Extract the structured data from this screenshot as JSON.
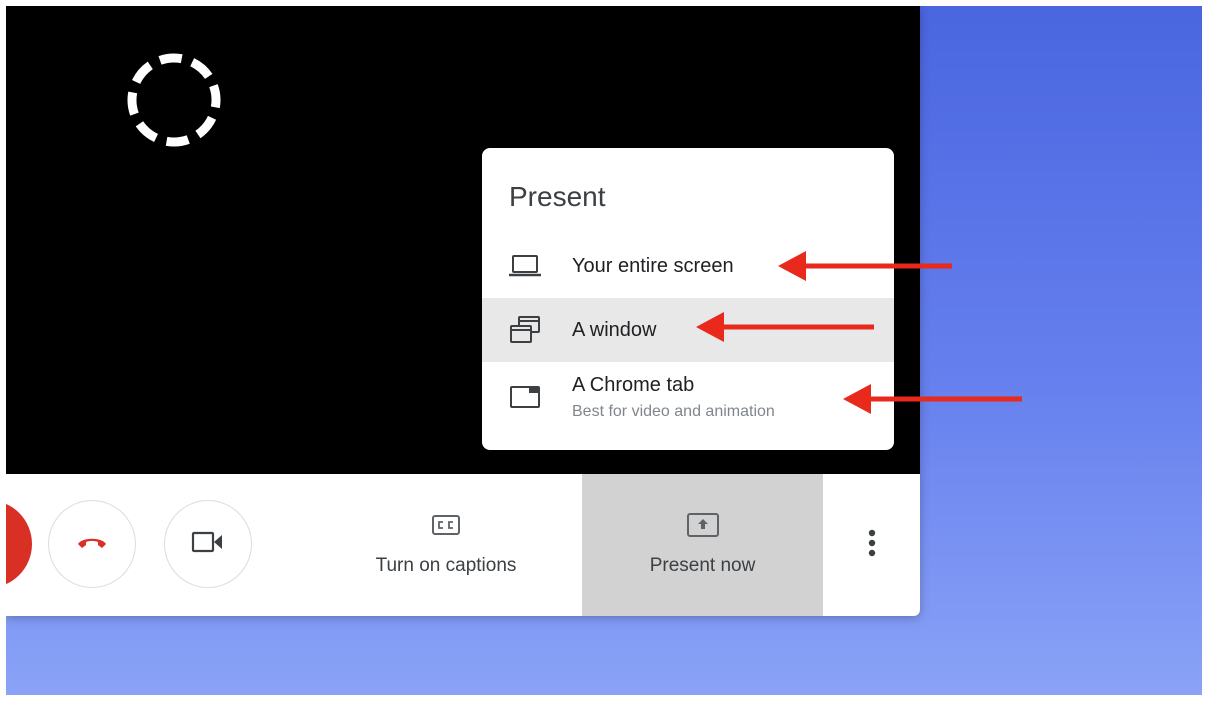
{
  "menu": {
    "title": "Present",
    "items": [
      {
        "label": "Your entire screen",
        "icon": "laptop-icon"
      },
      {
        "label": "A window",
        "icon": "window-icon"
      },
      {
        "label": "A Chrome tab",
        "sublabel": "Best for video and animation",
        "icon": "browser-tab-icon"
      }
    ],
    "highlighted_item": "A window"
  },
  "controls": {
    "captions_label": "Turn on captions",
    "present_label": "Present now"
  },
  "colors": {
    "hangup_red": "#d93025",
    "arrow_red": "#e8291c",
    "present_active_bg": "#d2d2d2",
    "desktop_blue": "#4a66e0"
  }
}
